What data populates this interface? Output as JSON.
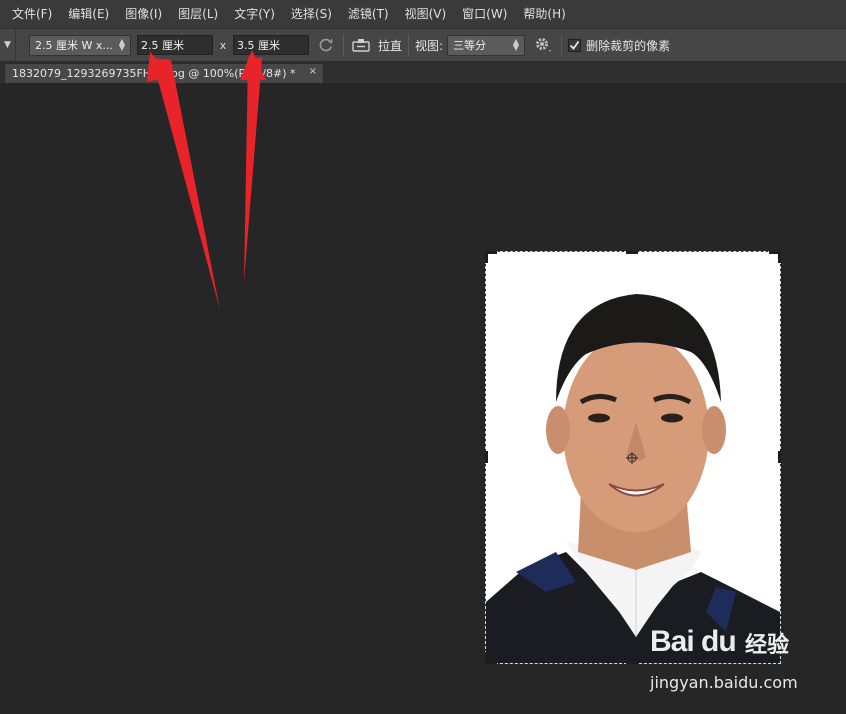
{
  "menu": [
    "文件(F)",
    "编辑(E)",
    "图像(I)",
    "图层(L)",
    "文字(Y)",
    "选择(S)",
    "滤镜(T)",
    "视图(V)",
    "窗口(W)",
    "帮助(H)"
  ],
  "options": {
    "preset": "2.5 厘米  W x...",
    "width_value": "2.5 厘米",
    "separator": "x",
    "height_value": "3.5 厘米",
    "straighten_label": "拉直",
    "view_label": "视图:",
    "view_value": "三等分",
    "delete_cropped_label": "删除裁剪的像素",
    "delete_cropped_checked": true
  },
  "document_tab": {
    "title": "1832079_1293269735FHTx.jpg @ 100%(RGB/8#) *",
    "close": "×"
  },
  "watermark": {
    "logo": "Bai  du",
    "suffix": "经验",
    "url": "jingyan.baidu.com"
  },
  "colors": {
    "background": "#262626",
    "menubar": "#3a3a3a",
    "optionsbar": "#464646",
    "arrow": "#e8232a"
  }
}
